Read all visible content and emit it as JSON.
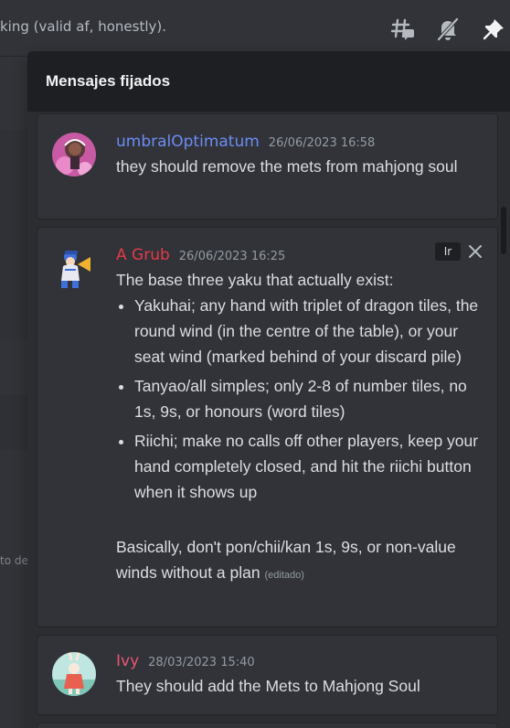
{
  "header": {
    "topic_text": "king (valid af, honestly).",
    "icons": [
      "threads-icon",
      "bell-slash-icon",
      "pin-icon"
    ]
  },
  "background": {
    "partial_text": "to de"
  },
  "pinned": {
    "title": "Mensajes fijados",
    "jump_label": "Ir",
    "messages": [
      {
        "author": "umbralOptimatum",
        "author_color": "#6c8cf5",
        "timestamp": "26/06/2023 16:58",
        "text": "they should remove the mets from mahjong soul"
      },
      {
        "author": "A Grub",
        "author_color": "#e6394a",
        "timestamp": "26/06/2023 16:25",
        "intro": "The base three yaku that actually exist:",
        "bullets": [
          "Yakuhai; any hand with triplet of dragon tiles, the round wind (in the centre of the table), or your seat wind (marked behind of your discard pile)",
          "Tanyao/all simples; only 2-8 of number tiles, no 1s, 9s, or honours (word tiles)",
          "Riichi; make no calls off other players, keep your hand completely closed, and hit the riichi button when it shows up"
        ],
        "outro": "Basically, don't pon/chii/kan 1s, 9s, or non-value winds without a plan",
        "edited": "(editado)"
      },
      {
        "author": "Ivy",
        "author_color": "#e85577",
        "timestamp": "28/03/2023 15:40",
        "text": "They should add the Mets to Mahjong Soul"
      }
    ]
  }
}
